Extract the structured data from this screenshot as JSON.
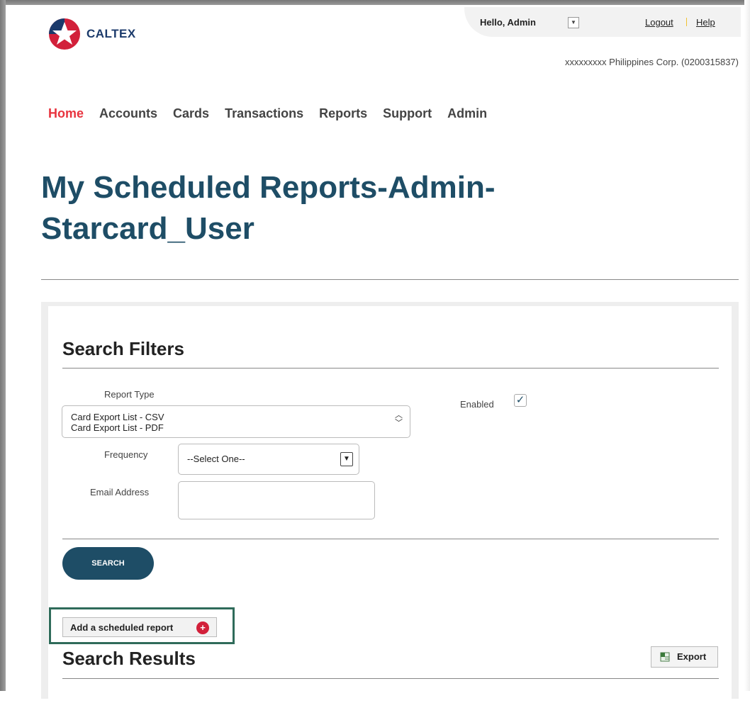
{
  "header": {
    "brand": "CALTEX",
    "greeting": "Hello, Admin",
    "logout": "Logout",
    "help": "Help",
    "corporation": "xxxxxxxxx Philippines Corp. (0200315837)"
  },
  "nav": {
    "items": [
      "Home",
      "Accounts",
      "Cards",
      "Transactions",
      "Reports",
      "Support",
      "Admin"
    ],
    "active": "Home"
  },
  "page": {
    "title_line1": "My Scheduled Reports-Admin-",
    "title_line2": "Starcard_User"
  },
  "filters": {
    "heading": "Search Filters",
    "report_type_label": "Report Type",
    "report_type_options": [
      "Card Export List - CSV",
      "Card Export List - PDF"
    ],
    "enabled_label": "Enabled",
    "enabled_checked": true,
    "frequency_label": "Frequency",
    "frequency_value": "--Select One--",
    "email_label": "Email Address",
    "email_value": "",
    "search_button": "SEARCH"
  },
  "actions": {
    "add_scheduled_report": "Add a scheduled report"
  },
  "results": {
    "heading": "Search Results",
    "export_button": "Export"
  },
  "colors": {
    "primary": "#1e4d66",
    "accent_red": "#e8343f",
    "highlight": "#2f6b5a"
  }
}
